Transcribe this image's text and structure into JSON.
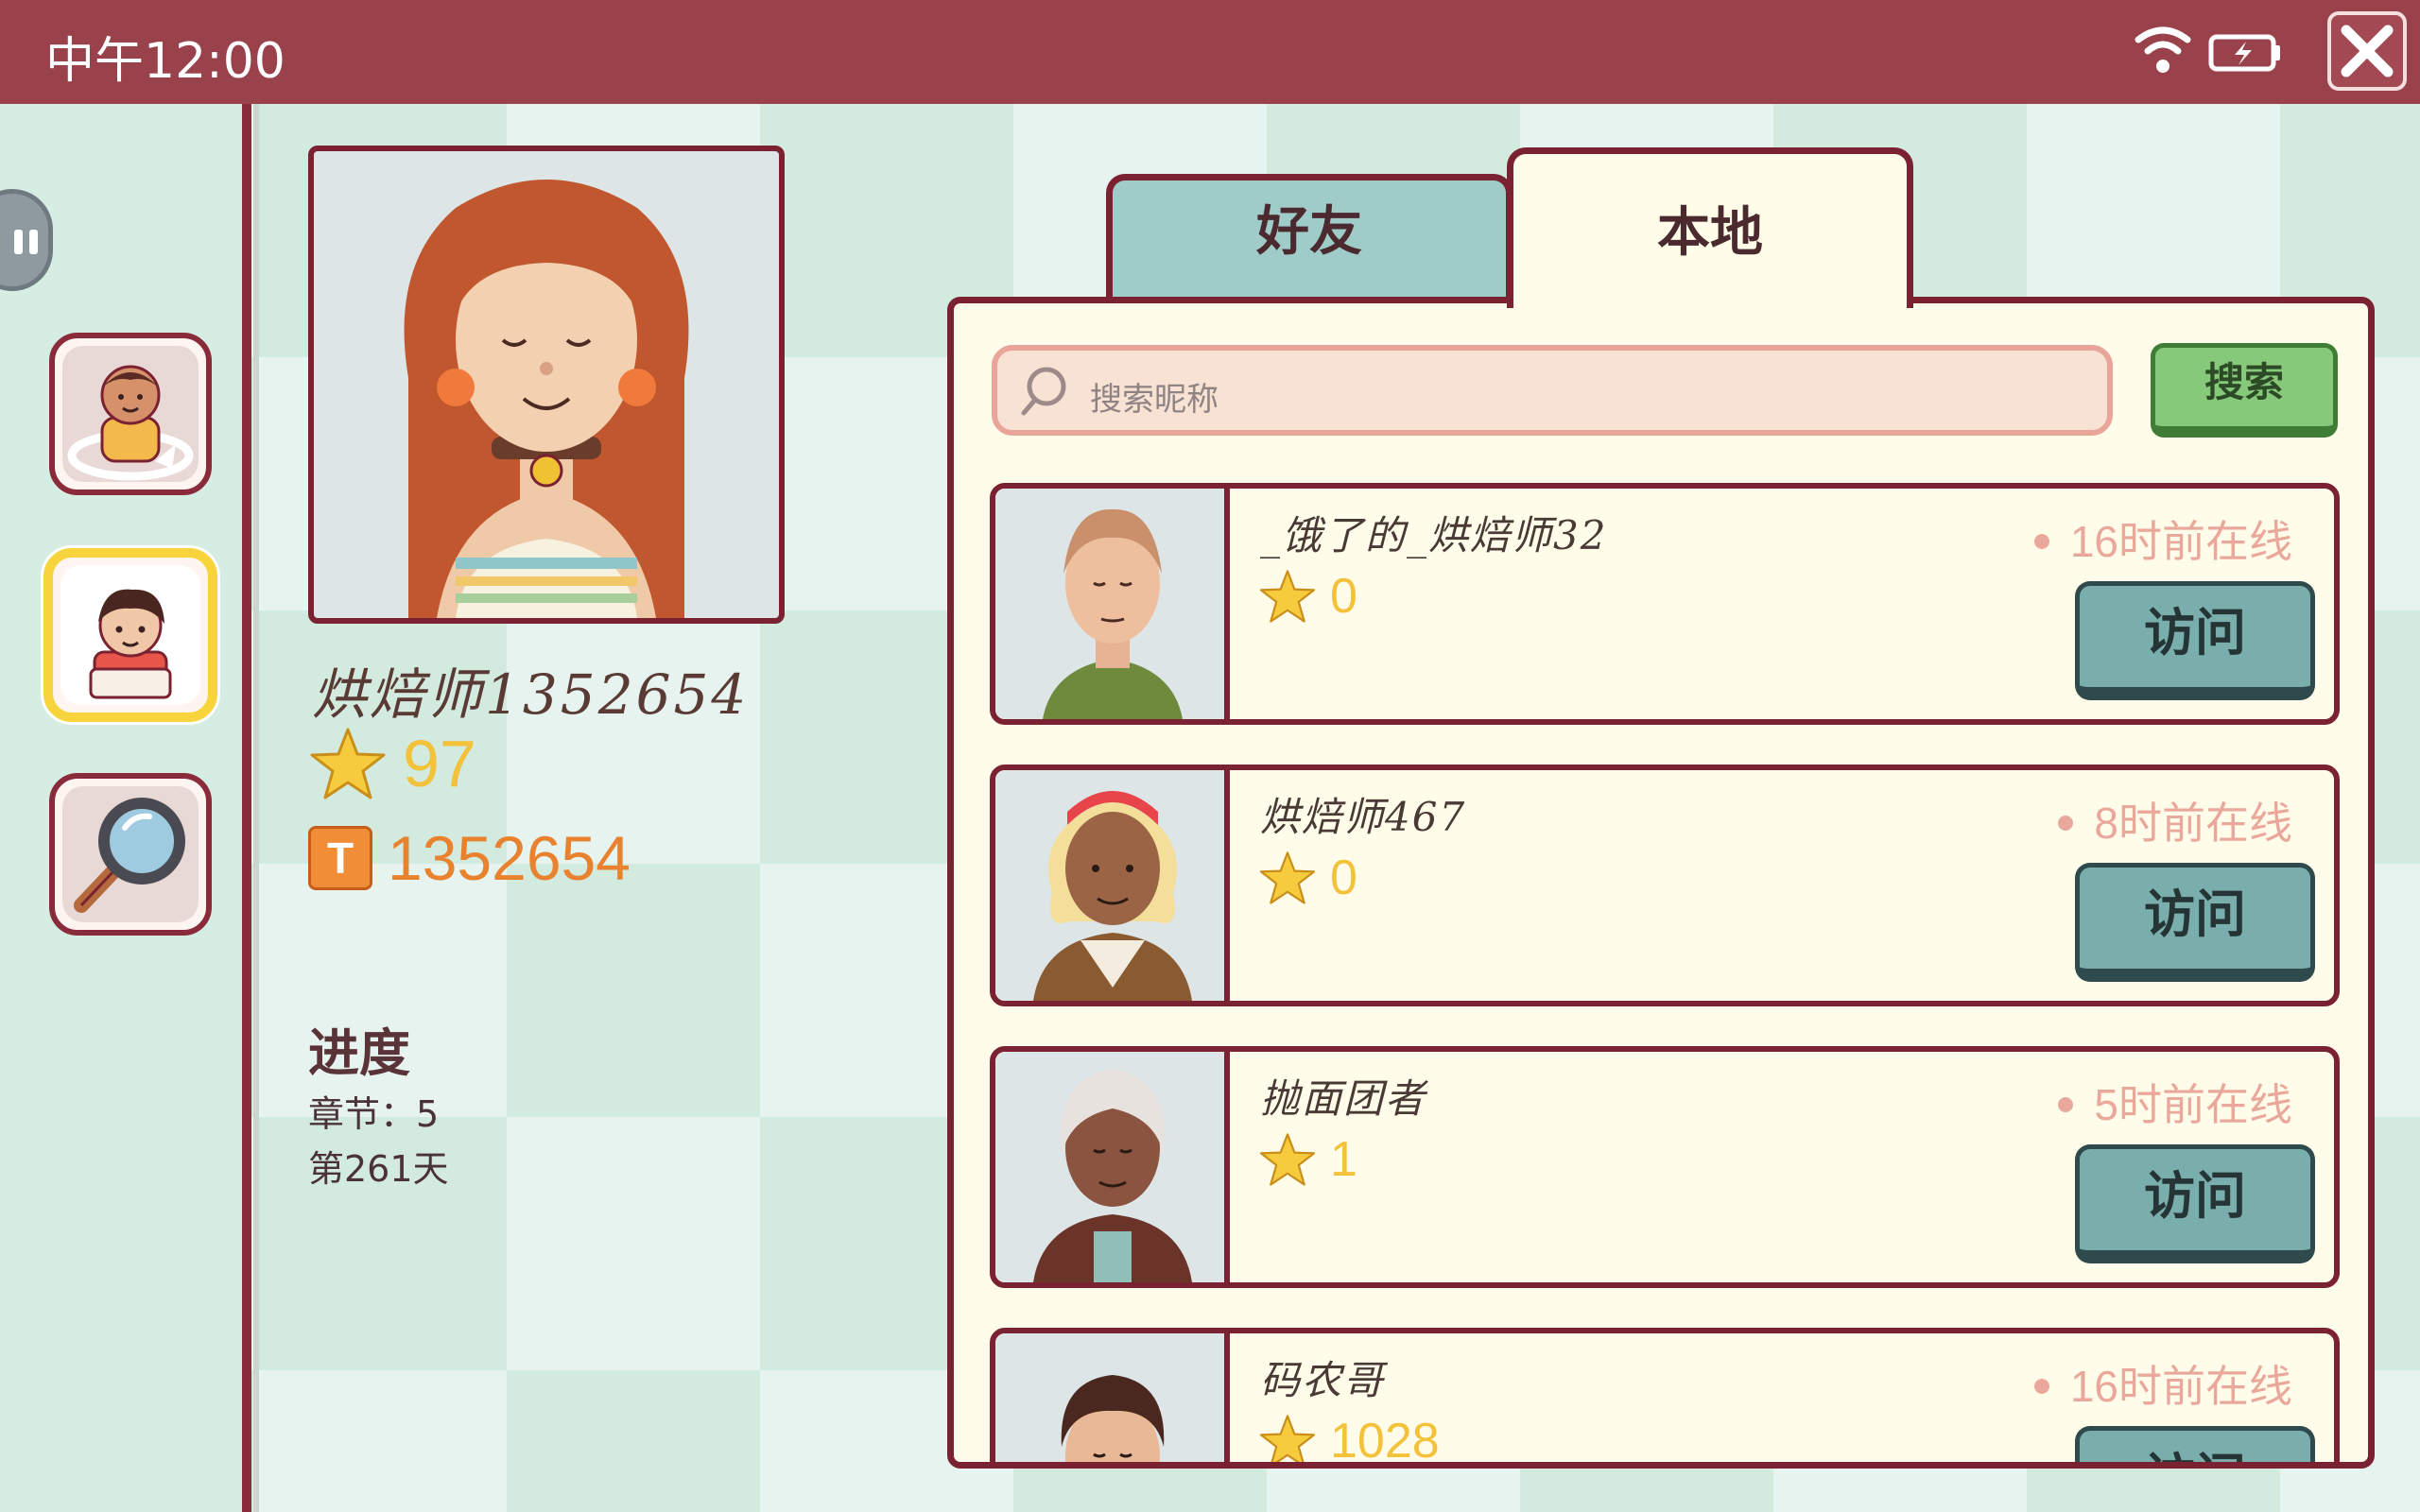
{
  "status_bar": {
    "time": "中午12:00"
  },
  "profile": {
    "username": "烘焙师1352654",
    "stars": "97",
    "coins": "1352654",
    "progress_title": "进度",
    "chapter": "章节：5",
    "day": "第261天"
  },
  "tabs": [
    {
      "label": "好友"
    },
    {
      "label": "本地"
    }
  ],
  "search": {
    "placeholder": "搜索昵称",
    "button": "搜索"
  },
  "players": [
    {
      "name": "_饿了的_烘焙师32",
      "stars": "0",
      "online": "16时前在线",
      "action": "访问"
    },
    {
      "name": "烘焙师467",
      "stars": "0",
      "online": "8时前在线",
      "action": "访问"
    },
    {
      "name": "抛面团者",
      "stars": "1",
      "online": "5时前在线",
      "action": "访问"
    },
    {
      "name": "码农哥",
      "stars": "1028",
      "online": "16时前在线",
      "action": "访问"
    }
  ],
  "colors": {
    "maroon": "#7a2232",
    "star": "#f4c13b",
    "coin": "#e8822e",
    "online": "#eaa89d"
  }
}
